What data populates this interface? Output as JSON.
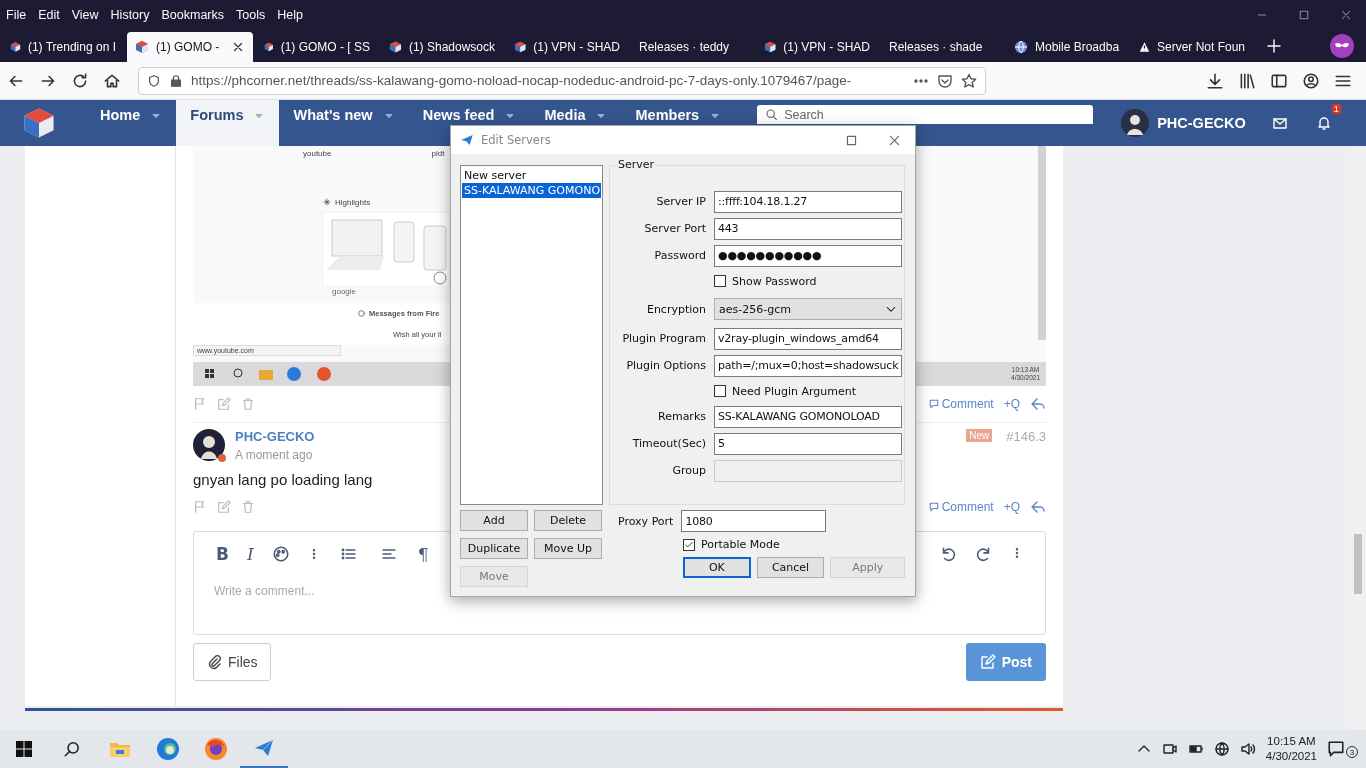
{
  "menu_bar": [
    "File",
    "Edit",
    "View",
    "History",
    "Bookmarks",
    "Tools",
    "Help"
  ],
  "tabs": [
    {
      "label": "(1) Trending on I",
      "kind": "site",
      "selected": false
    },
    {
      "label": "(1) GOMO -",
      "kind": "site",
      "selected": true
    },
    {
      "label": "(1) GOMO - [ SS",
      "kind": "site",
      "selected": false
    },
    {
      "label": "(1) Shadowsock",
      "kind": "site",
      "selected": false
    },
    {
      "label": "(1) VPN - SHAD",
      "kind": "site",
      "selected": false
    },
    {
      "label": "Releases · teddy",
      "kind": "blank",
      "selected": false
    },
    {
      "label": "(1) VPN - SHAD",
      "kind": "site",
      "selected": false
    },
    {
      "label": "Releases · shade",
      "kind": "blank",
      "selected": false
    },
    {
      "label": "Mobile Broadba",
      "kind": "globe",
      "selected": false
    },
    {
      "label": "Server Not Foun",
      "kind": "warning",
      "selected": false
    }
  ],
  "url": "https://phcorner.net/threads/ss-kalawang-gomo-noload-nocap-nodeduc-android-pc-7-days-only.1079467/page-",
  "site_nav": {
    "items": [
      {
        "label": "Home",
        "selected": false
      },
      {
        "label": "Forums",
        "selected": true
      },
      {
        "label": "What's new",
        "selected": false
      },
      {
        "label": "News feed",
        "selected": false
      },
      {
        "label": "Media",
        "selected": false
      },
      {
        "label": "Members",
        "selected": false
      }
    ],
    "search": {
      "placeholder": "Search"
    },
    "user": "PHC-GECKO",
    "alerts": "1"
  },
  "embedded_screenshot": {
    "shortcuts": [
      "youtube",
      "pldt"
    ],
    "section": "Highlights",
    "card_label": "google",
    "message": "Messages from Fire",
    "message_body": "Wish all your li",
    "status_url": "www.youtube.com",
    "time": "10:13 AM",
    "date": "4/30/2021"
  },
  "post_actions": [
    {
      "comment": "Comment",
      "quote": "+Q"
    },
    {
      "comment": "Comment",
      "quote": "+Q"
    }
  ],
  "post": {
    "author": "PHC-GECKO",
    "time": "A moment ago",
    "badge": "New",
    "number": "#146.3",
    "body": "gnyan lang po loading lang"
  },
  "editor": {
    "tools": [
      "B",
      "I",
      "¶"
    ],
    "placeholder": "Write a comment...",
    "files": "Files",
    "post": "Post"
  },
  "dialog": {
    "title": "Edit Servers",
    "servers": [
      {
        "label": "New server",
        "selected": false
      },
      {
        "label": "SS-KALAWANG GOMONO",
        "selected": true
      }
    ],
    "group_title": "Server",
    "fields": [
      {
        "kind": "text",
        "label": "Server IP",
        "value": "::ffff:104.18.1.27",
        "disabled": false
      },
      {
        "kind": "text",
        "label": "Server Port",
        "value": "443",
        "disabled": false
      },
      {
        "kind": "text",
        "label": "Password",
        "value": "●●●●●●●●●●●",
        "disabled": false
      },
      {
        "kind": "checkbox",
        "label": "Show Password",
        "checked": false
      },
      {
        "kind": "select",
        "label": "Encryption",
        "value": "aes-256-gcm"
      },
      {
        "kind": "text",
        "label": "Plugin Program",
        "value": "v2ray-plugin_windows_amd64",
        "disabled": false
      },
      {
        "kind": "text",
        "label": "Plugin Options",
        "value": "path=/;mux=0;host=shadowsuck",
        "disabled": false
      },
      {
        "kind": "checkbox",
        "label": "Need Plugin Argument",
        "checked": false
      },
      {
        "kind": "text",
        "label": "Remarks",
        "value": "SS-KALAWANG GOMONOLOAD",
        "disabled": false
      },
      {
        "kind": "text",
        "label": "Timeout(Sec)",
        "value": "5",
        "disabled": false
      },
      {
        "kind": "text",
        "label": "Group",
        "disabled": true
      }
    ],
    "list_buttons": [
      {
        "label": "Add",
        "disabled": false
      },
      {
        "label": "Delete",
        "disabled": false
      },
      {
        "label": "Duplicate",
        "disabled": false
      },
      {
        "label": "Move Up",
        "disabled": false
      },
      {
        "label": "Move",
        "disabled": true
      }
    ],
    "proxy_port": {
      "label": "Proxy Port",
      "value": "1080"
    },
    "portable_mode": {
      "label": "Portable Mode",
      "checked": true
    },
    "buttons": [
      {
        "label": "OK",
        "default": true,
        "disabled": false
      },
      {
        "label": "Cancel",
        "default": false,
        "disabled": false
      },
      {
        "label": "Apply",
        "default": false,
        "disabled": true
      }
    ]
  },
  "taskbar": {
    "time": "10:15 AM",
    "date": "4/30/2021",
    "notifications": "3"
  }
}
